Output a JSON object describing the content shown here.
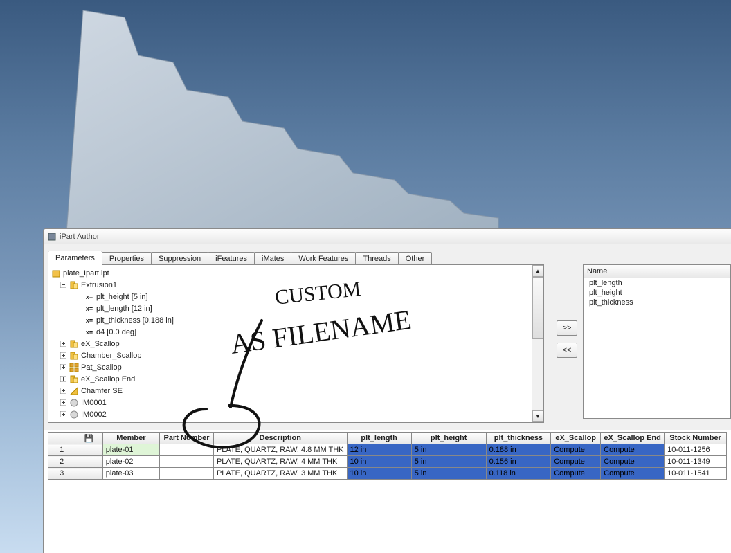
{
  "window": {
    "title": "iPart Author"
  },
  "tabs": [
    "Parameters",
    "Properties",
    "Suppression",
    "iFeatures",
    "iMates",
    "Work Features",
    "Threads",
    "Other"
  ],
  "activeTab": 0,
  "tree": {
    "root": "plate_Ipart.ipt",
    "extrusion": "Extrusion1",
    "params": [
      "plt_height [5 in]",
      "plt_length [12 in]",
      "plt_thickness [0.188 in]",
      "d4 [0.0 deg]"
    ],
    "features": [
      "eX_Scallop",
      "Chamber_Scallop",
      "Pat_Scallop",
      "eX_Scallop End",
      "Chamfer SE",
      "IM0001",
      "IM0002"
    ]
  },
  "namePanel": {
    "header": "Name",
    "items": [
      "plt_length",
      "plt_height",
      "plt_thickness"
    ]
  },
  "moveBtns": {
    "right": ">>",
    "left": "<<"
  },
  "grid": {
    "headers": [
      "",
      "Member",
      "Part Number",
      "Description",
      "plt_length",
      "plt_height",
      "plt_thickness",
      "eX_Scallop",
      "eX_Scallop End",
      "Stock Number"
    ],
    "saveIcon": "💾",
    "rows": [
      {
        "n": "1",
        "member": "plate-01",
        "pn": "",
        "desc": "PLATE, QUARTZ, RAW, 4.8 MM THK",
        "len": "12 in",
        "h": "5 in",
        "thk": "0.188 in",
        "sc": "Compute",
        "sce": "Compute",
        "stock": "10-011-1256",
        "first": true
      },
      {
        "n": "2",
        "member": "plate-02",
        "pn": "",
        "desc": "PLATE, QUARTZ, RAW, 4 MM THK",
        "len": "10 in",
        "h": "5 in",
        "thk": "0.156 in",
        "sc": "Compute",
        "sce": "Compute",
        "stock": "10-011-1349"
      },
      {
        "n": "3",
        "member": "plate-03",
        "pn": "",
        "desc": "PLATE, QUARTZ, RAW, 3 MM THK",
        "len": "10 in",
        "h": "5 in",
        "thk": "0.118 in",
        "sc": "Compute",
        "sce": "Compute",
        "stock": "10-011-1541"
      }
    ]
  },
  "annotation": {
    "line1": "CUSTOM",
    "line2": "AS FILENAME"
  },
  "colWidths": [
    "40",
    "17",
    "83",
    "78",
    "176",
    "94",
    "109",
    "94",
    "72",
    "92",
    "90"
  ]
}
